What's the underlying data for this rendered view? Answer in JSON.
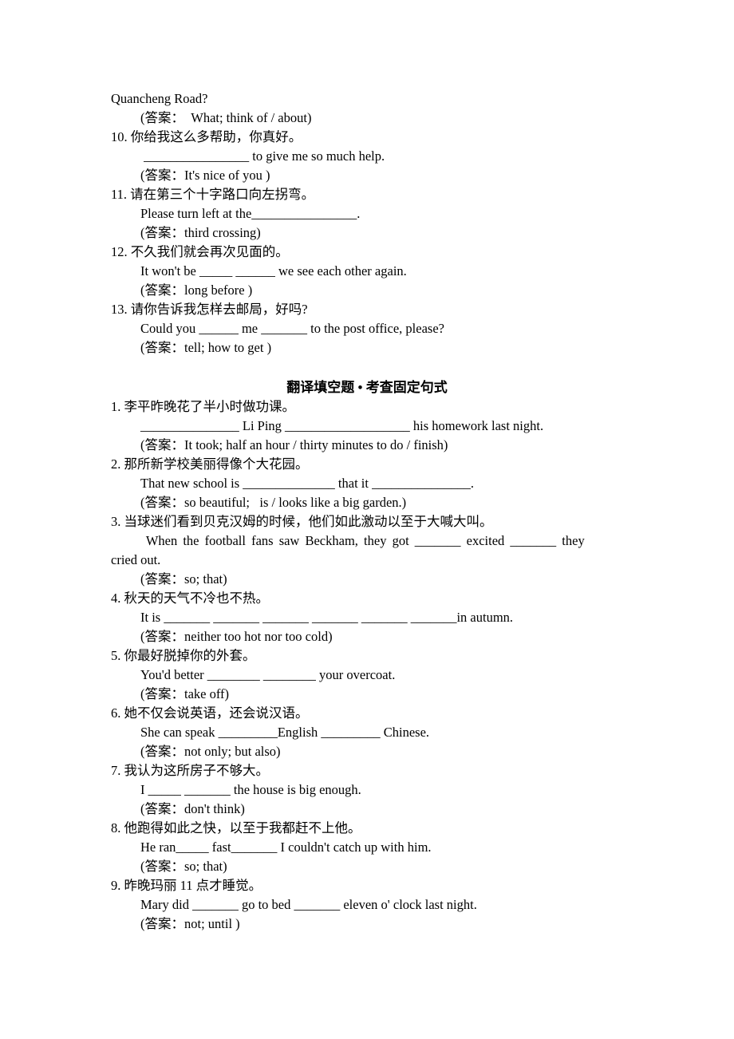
{
  "document": {
    "top_items": [
      {
        "prompt": null,
        "sentence": "Quancheng Road?",
        "answer": "(答案：  What; think of / about)"
      },
      {
        "number": "10.",
        "prompt": "你给我这么多帮助，你真好。",
        "sentence": " ________________ to give me so much help.",
        "answer": "(答案：It's nice of you )"
      },
      {
        "number": "11.",
        "prompt": "请在第三个十字路口向左拐弯。",
        "sentence": "Please turn left at the________________.",
        "answer": "(答案：third crossing)"
      },
      {
        "number": "12.",
        "prompt": "不久我们就会再次见面的。",
        "sentence": "It won't be _____ ______ we see each other again.",
        "answer": "(答案：long before )"
      },
      {
        "number": "13.",
        "prompt": "请你告诉我怎样去邮局，好吗?",
        "sentence": "Could you ______ me _______ to the post office, please?",
        "answer": "(答案：tell; how to get )"
      }
    ],
    "section_title": "翻译填空题 • 考查固定句式",
    "items": [
      {
        "number": "1.",
        "prompt": "李平昨晚花了半小时做功课。",
        "sentence": "_______________ Li Ping ___________________ his homework last night.",
        "answer": "(答案：It took; half an hour / thirty minutes to do / finish)"
      },
      {
        "number": "2.",
        "prompt": "那所新学校美丽得像个大花园。",
        "sentence": "That new school is ______________ that it _______________.",
        "answer": "(答案：so beautiful;   is / looks like a big garden.)"
      },
      {
        "number": "3.",
        "prompt": "当球迷们看到贝克汉姆的时候，他们如此激动以至于大喊大叫。",
        "sentence": " When the football fans saw Beckham, they got _______ excited _______ they",
        "sentence_cont": "cried out.",
        "answer": "(答案：so; that)"
      },
      {
        "number": "4.",
        "prompt": "秋天的天气不冷也不热。",
        "sentence": "It is _______ _______ _______ _______ _______ _______in autumn.",
        "answer": "(答案：neither too hot nor too cold)"
      },
      {
        "number": "5.",
        "prompt": "你最好脱掉你的外套。",
        "sentence": "You'd better ________ ________ your overcoat.",
        "answer": "(答案：take off)"
      },
      {
        "number": "6.",
        "prompt": "她不仅会说英语，还会说汉语。",
        "sentence": "She can speak _________English _________ Chinese.",
        "answer": "(答案：not only; but also)"
      },
      {
        "number": "7.",
        "prompt": "我认为这所房子不够大。",
        "sentence": "I _____ _______ the house is big enough.",
        "answer": "(答案：don't think)"
      },
      {
        "number": "8.",
        "prompt": "他跑得如此之快，以至于我都赶不上他。",
        "sentence": "He ran_____ fast_______ I couldn't catch up with him.",
        "answer": "(答案：so; that)"
      },
      {
        "number": "9.",
        "prompt": "昨晚玛丽 11 点才睡觉。",
        "sentence": "Mary did _______ go to bed _______ eleven o' clock last night.",
        "answer": "(答案：not; until )"
      }
    ]
  }
}
